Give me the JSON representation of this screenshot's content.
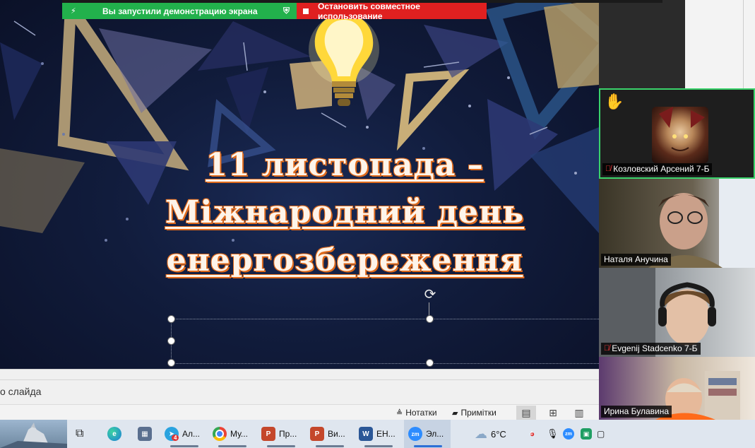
{
  "share_bar": {
    "sharing_text": "Вы запустили демонстрацию экрана",
    "stop_text": "Остановить совместное использование",
    "green": "#22b14c",
    "red": "#e02020"
  },
  "slide": {
    "title_line1": "11 листопада –",
    "title_line2": "Міжнародний день",
    "title_line3": "енергозбереження",
    "title_color": "#fdf4ea",
    "title_outline_color": "#e06a1b"
  },
  "notes": {
    "placeholder_fragment": "о слайда"
  },
  "statusbar": {
    "notes_label": "Нотатки",
    "comments_label": "Примітки",
    "views": [
      "normal-view-icon",
      "slide-sorter-icon",
      "reading-view-icon"
    ]
  },
  "participants": [
    {
      "name": "Козловский Арсений 7-Б",
      "muted": true,
      "hand_raised": true,
      "active_speaker": true
    },
    {
      "name": "Наталя Анучина",
      "muted": false,
      "hand_raised": false
    },
    {
      "name": "Evgenij Stadcenko 7-Б",
      "muted": true,
      "hand_raised": false
    },
    {
      "name": "Ирина Булавина",
      "muted": false,
      "hand_raised": false
    }
  ],
  "taskbar": {
    "apps": [
      {
        "label": "",
        "icon": "wolf-wallpaper-icon"
      },
      {
        "label": "",
        "icon": "task-view-icon"
      },
      {
        "label": "",
        "icon": "edge-icon"
      },
      {
        "label": "",
        "icon": "calculator-icon"
      },
      {
        "label": "Ал...",
        "icon": "telegram-icon",
        "badge": "4"
      },
      {
        "label": "Му...",
        "icon": "chrome-icon"
      },
      {
        "label": "Пр...",
        "icon": "powerpoint-icon"
      },
      {
        "label": "Ви...",
        "icon": "powerpoint-icon"
      },
      {
        "label": "ЕН...",
        "icon": "word-icon"
      },
      {
        "label": "Эл...",
        "icon": "zoom-icon"
      }
    ],
    "weather_temp": "6°C",
    "tray_badge": "4"
  }
}
